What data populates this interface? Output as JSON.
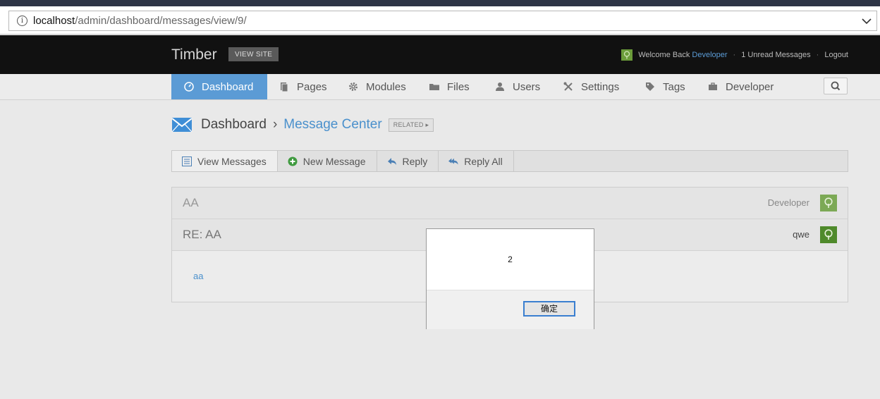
{
  "browser": {
    "url_host": "localhost",
    "url_path": "/admin/dashboard/messages/view/9/"
  },
  "header": {
    "brand": "Timber",
    "view_site": "VIEW SITE",
    "welcome_text": "Welcome Back",
    "user_name": "Developer",
    "unread": "1 Unread Messages",
    "logout": "Logout"
  },
  "nav": {
    "items": [
      {
        "label": "Dashboard",
        "icon": "dashboard-icon"
      },
      {
        "label": "Pages",
        "icon": "pages-icon"
      },
      {
        "label": "Modules",
        "icon": "gear-icon"
      },
      {
        "label": "Files",
        "icon": "folder-icon"
      },
      {
        "label": "Users",
        "icon": "user-icon"
      },
      {
        "label": "Settings",
        "icon": "tools-icon"
      },
      {
        "label": "Tags",
        "icon": "tag-icon"
      },
      {
        "label": "Developer",
        "icon": "briefcase-icon"
      }
    ],
    "active": "Dashboard"
  },
  "breadcrumb": {
    "root": "Dashboard",
    "separator": "›",
    "current": "Message Center",
    "related": "RELATED"
  },
  "toolbar": {
    "view_messages": "View Messages",
    "new_message": "New Message",
    "reply": "Reply",
    "reply_all": "Reply All"
  },
  "messages": [
    {
      "subject": "AA",
      "author": "Developer"
    },
    {
      "subject": "RE: AA",
      "author": "qwe"
    }
  ],
  "message_body": "aa",
  "dialog": {
    "message": "2",
    "ok_label": "确定"
  },
  "colors": {
    "accent": "#5b9bd5",
    "header_bg": "#111111",
    "avatar_green": "#6b9c3a"
  }
}
